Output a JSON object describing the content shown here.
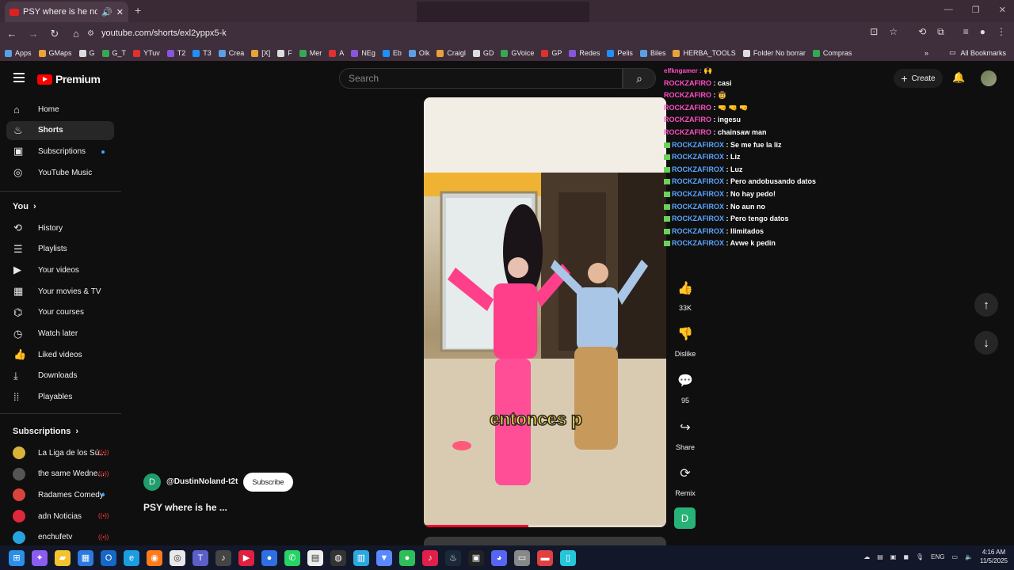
{
  "browser": {
    "tab_title": "PSY where is he now #fyp",
    "url": "youtube.com/shorts/exl2yppx5-k",
    "bookmarks": [
      "Apps",
      "GMaps",
      "G",
      "G_T",
      "YTuv",
      "T2",
      "T3",
      "Crea",
      "[X]",
      "F",
      "Mer",
      "A",
      "NEg",
      "Eb",
      "Olk",
      "Craigl",
      "GD",
      "GVoice",
      "GP",
      "Redes",
      "Pelis",
      "Biles",
      "HERBA_TOOLS",
      "Folder No borrar",
      "Compras"
    ],
    "all_bookmarks": "All Bookmarks"
  },
  "header": {
    "brand": "Premium",
    "search_placeholder": "Search",
    "create_label": "Create"
  },
  "sidebar": {
    "main": [
      {
        "label": "Home",
        "icon": "home-icon"
      },
      {
        "label": "Shorts",
        "icon": "shorts-icon"
      },
      {
        "label": "Subscriptions",
        "icon": "subscriptions-icon"
      },
      {
        "label": "YouTube Music",
        "icon": "music-icon"
      }
    ],
    "you_title": "You",
    "you": [
      {
        "label": "History"
      },
      {
        "label": "Playlists"
      },
      {
        "label": "Your videos"
      },
      {
        "label": "Your movies & TV"
      },
      {
        "label": "Your courses"
      },
      {
        "label": "Watch later"
      },
      {
        "label": "Liked videos"
      },
      {
        "label": "Downloads"
      },
      {
        "label": "Playables"
      }
    ],
    "subs_title": "Subscriptions",
    "subs": [
      {
        "label": "La Liga de los Sú..."
      },
      {
        "label": "the same Wedne..."
      },
      {
        "label": "Radames Comedy"
      },
      {
        "label": "adn Noticias"
      },
      {
        "label": "enchufetv"
      }
    ]
  },
  "short": {
    "caption": "entonces p",
    "channel": "@DustinNoland-t2t",
    "channel_initial": "D",
    "subscribe_label": "Subscribe",
    "title": "PSY where is he ...",
    "progress": 0.43,
    "likes": "33K",
    "dislike_label": "Dislike",
    "comments": "95",
    "share_label": "Share",
    "remix_label": "Remix"
  },
  "chat": [
    {
      "user": "ROCKZAFIRO",
      "msg": ": casi",
      "color": "pink"
    },
    {
      "user": "ROCKZAFIRO",
      "msg": ": 🤠",
      "color": "pink"
    },
    {
      "user": "ROCKZAFIRO",
      "msg": ": 🤜 🤜 🤜",
      "color": "pink"
    },
    {
      "user": "ROCKZAFIRO",
      "msg": ": ingesu",
      "color": "pink"
    },
    {
      "user": "ROCKZAFIRO",
      "msg": ": chainsaw man",
      "color": "pink"
    },
    {
      "user": "ROCKZAFIROX",
      "msg": ": Se me fue la liz",
      "color": "blue"
    },
    {
      "user": "ROCKZAFIROX",
      "msg": ": Liz",
      "color": "blue"
    },
    {
      "user": "ROCKZAFIROX",
      "msg": ": Luz",
      "color": "blue"
    },
    {
      "user": "ROCKZAFIROX",
      "msg": ": Pero andobusando datos",
      "color": "blue"
    },
    {
      "user": "ROCKZAFIROX",
      "msg": ": No hay pedo!",
      "color": "blue"
    },
    {
      "user": "ROCKZAFIROX",
      "msg": ": No aun no",
      "color": "blue"
    },
    {
      "user": "ROCKZAFIROX",
      "msg": ": Pero tengo datos",
      "color": "blue"
    },
    {
      "user": "ROCKZAFIROX",
      "msg": ": Ilimitados",
      "color": "blue"
    },
    {
      "user": "ROCKZAFIROX",
      "msg": ": Avwe k pedin",
      "color": "blue"
    }
  ],
  "chat_top": "elfkngamer :",
  "taskbar": {
    "lang": "ENG",
    "time": "4:16 AM",
    "date": "11/5/2025"
  }
}
